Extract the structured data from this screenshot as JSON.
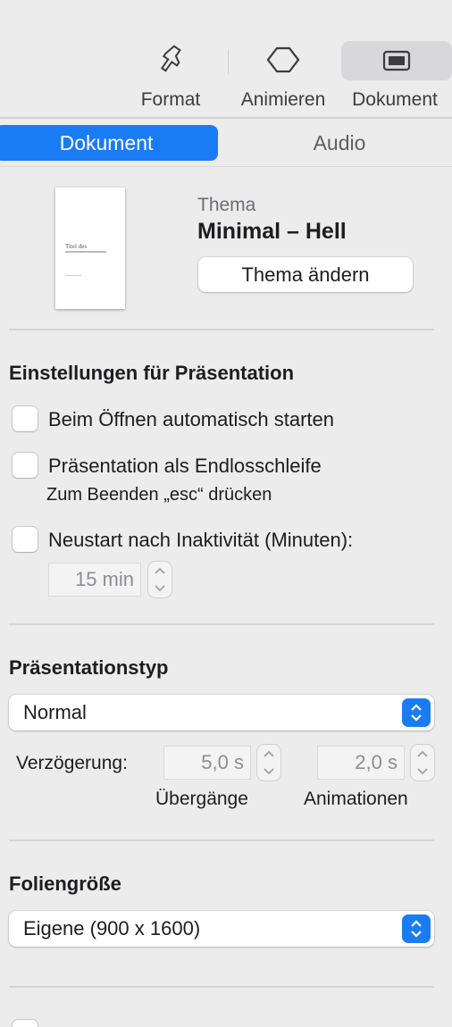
{
  "toolbar": {
    "format_label": "Format",
    "animate_label": "Animieren",
    "document_label": "Dokument"
  },
  "tabs": {
    "document": "Dokument",
    "audio": "Audio"
  },
  "theme": {
    "label": "Thema",
    "name": "Minimal – Hell",
    "change_button": "Thema ändern"
  },
  "presentation_settings": {
    "title": "Einstellungen für Präsentation",
    "autostart_label": "Beim Öffnen automatisch starten",
    "autostart_checked": false,
    "loop_label": "Präsentation als Endlosschleife",
    "loop_checked": false,
    "loop_hint": "Zum Beenden „esc“ drücken",
    "restart_label": "Neustart nach Inaktivität (Minuten):",
    "restart_checked": false,
    "restart_value": "15 min"
  },
  "presentation_type": {
    "title": "Präsentationstyp",
    "selected": "Normal",
    "delay_label": "Verzögerung:",
    "transitions_value": "5,0 s",
    "transitions_label": "Übergänge",
    "animations_value": "2,0 s",
    "animations_label": "Animationen"
  },
  "slide_size": {
    "title": "Foliengröße",
    "selected": "Eigene (900 x 1600)"
  },
  "colors": {
    "accent": "#1a7cf5",
    "panel": "#ececed"
  }
}
